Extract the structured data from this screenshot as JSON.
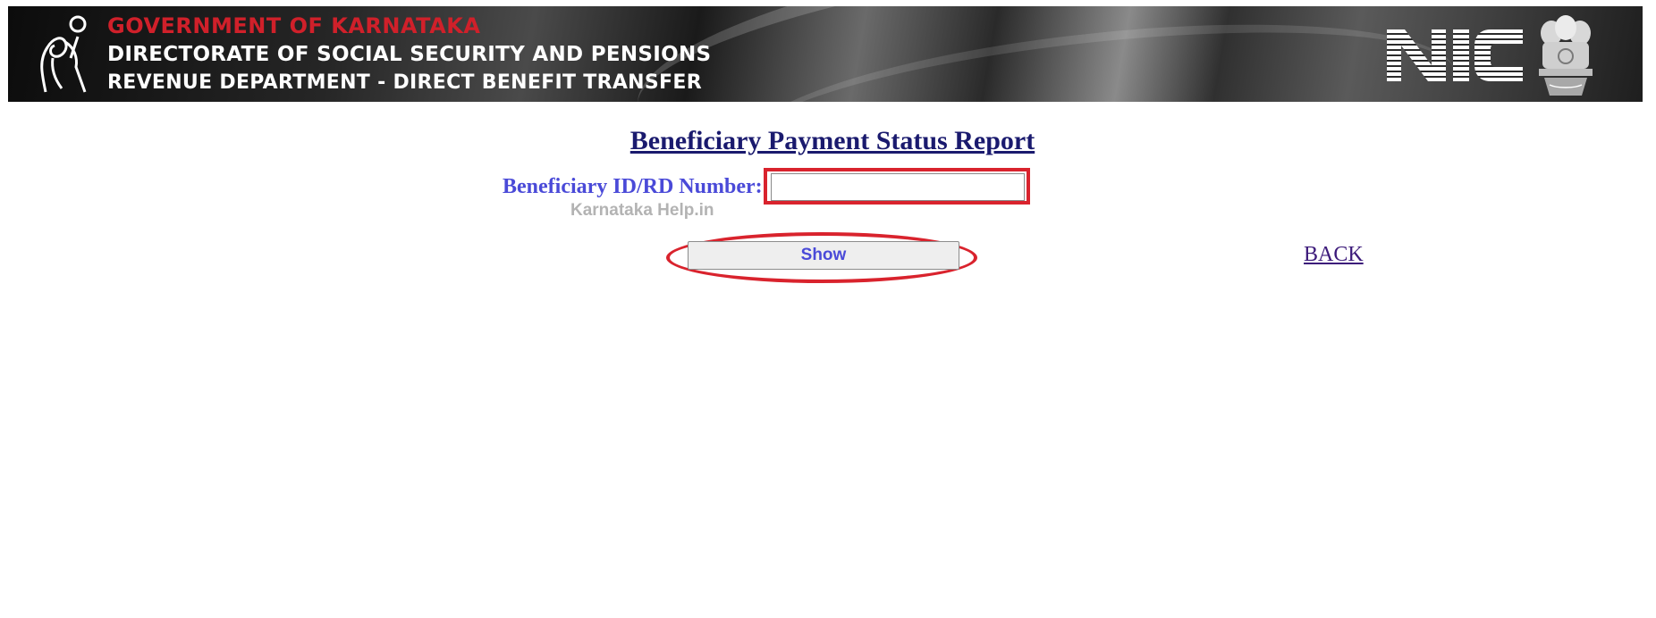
{
  "header": {
    "line1": "GOVERNMENT OF KARNATAKA",
    "line2": "DIRECTORATE OF SOCIAL SECURITY AND PENSIONS",
    "line3_main": "REVENUE DEPARTMENT",
    "line3_sub": " - DIRECT BENEFIT TRANSFER",
    "right_logo_text": "NIC",
    "left_logo_icon": "pension-figure-icon",
    "emblem_icon": "national-emblem-icon",
    "colors": {
      "line1": "#d0202a",
      "text": "#ffffff"
    }
  },
  "main": {
    "title": "Beneficiary Payment Status Report",
    "field_label": "Beneficiary ID/RD Number:",
    "field_value": "",
    "field_placeholder": "",
    "watermark": "Karnataka Help.in",
    "show_button": "Show",
    "back_link": "BACK"
  },
  "colors": {
    "title": "#1a1a6e",
    "label": "#4a4ad8",
    "highlight": "#d9232d",
    "link": "#3c1a7a"
  }
}
